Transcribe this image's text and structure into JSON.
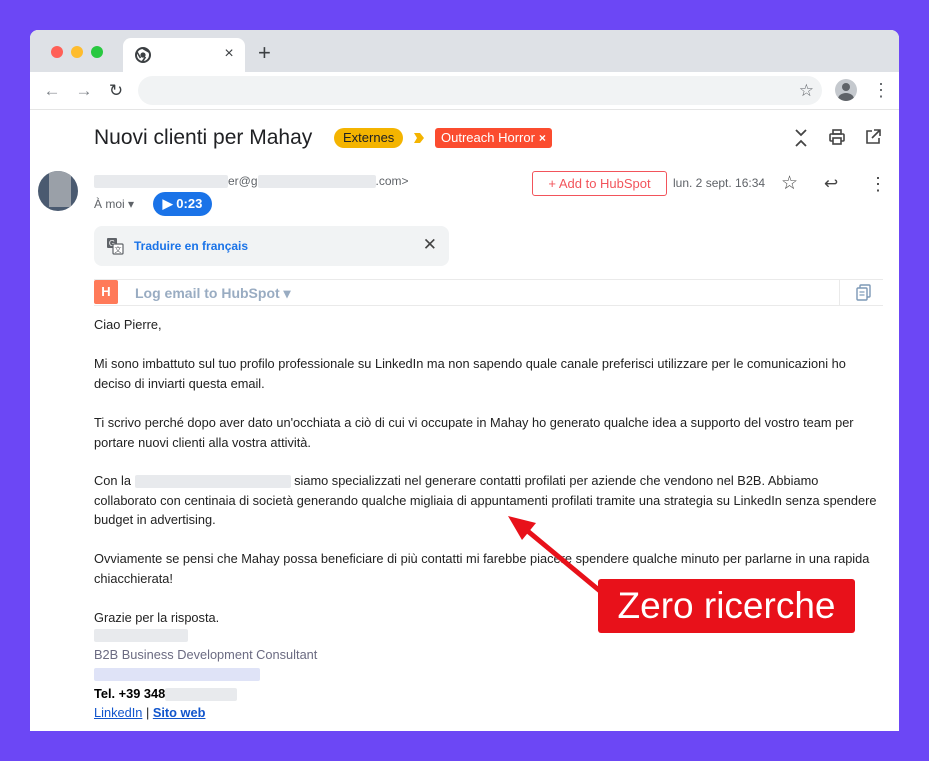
{
  "browser": {
    "tab_close": "×",
    "new_tab": "+",
    "back_icon": "←",
    "forward_icon": "→",
    "reload_icon": "↻",
    "bookmark_icon": "☆",
    "menu_icon": "⋮"
  },
  "email": {
    "subject": "Nuovi clienti per Mahay",
    "labels": {
      "externes": "Externes",
      "outreach": "Outreach Horror",
      "outreach_remove": "×"
    },
    "sender_fragment_1": "er@g",
    "sender_fragment_2": ".com>",
    "recipient": "À moi",
    "recipient_caret": "▾",
    "voice_note": "▶ 0:23",
    "hubspot_add": "+ Add to HubSpot",
    "date": "lun. 2 sept. 16:34",
    "star_icon": "☆",
    "reply_icon": "↩",
    "more_icon": "⋮",
    "translate": "Traduire en français",
    "translate_close": "✕",
    "hubspot_log": "Log email to HubSpot ▾",
    "hubspot_logo": "H",
    "body": {
      "greeting": "Ciao Pierre,",
      "p2": "Mi sono imbattuto sul tuo profilo professionale su LinkedIn ma non sapendo quale canale preferisci utilizzare per le comunicazioni ho deciso di inviarti questa email.",
      "p3": "Ti scrivo perché dopo aver dato un'occhiata a ciò di cui vi occupate in Mahay ho generato qualche idea a supporto del vostro team per portare nuovi clienti alla vostra attività.",
      "p4_start": "Con la ",
      "p4_rest": " siamo specializzati nel generare contatti profilati per aziende che vendono nel B2B. Abbiamo collaborato con centinaia di società generando qualche migliaia di appuntamenti profilati tramite una strategia su LinkedIn senza spendere budget in advertising.",
      "p5": "Ovviamente se pensi che Mahay possa beneficiare di più contatti mi farebbe piacere spendere qualche minuto per parlarne in una rapida chiacchierata!",
      "p6": "Grazie per la risposta."
    },
    "signature": {
      "role": "B2B Business Development Consultant",
      "tel": "Tel. +39 348",
      "linkedin": "LinkedIn",
      "separator": " | ",
      "website": "Sito web"
    }
  },
  "annotation": {
    "text": "Zero ricerche",
    "color": "#e8111a"
  },
  "colors": {
    "background": "#6c47f5",
    "link_blue": "#1a73e8",
    "hubspot_orange": "#ff7a59",
    "label_yellow": "#f4b400",
    "label_red": "#fb4c2f"
  }
}
